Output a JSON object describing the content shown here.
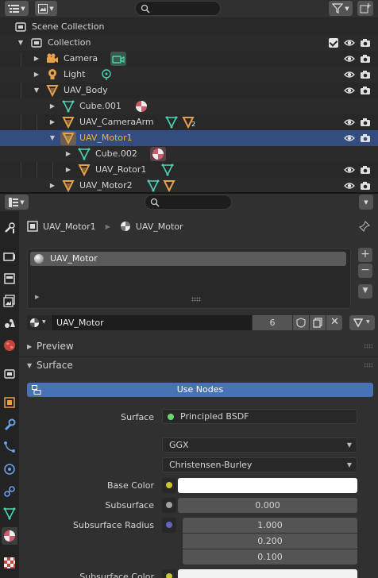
{
  "outliner": {
    "search_placeholder": "",
    "rows": [
      {
        "label": "Scene Collection"
      },
      {
        "label": "Collection"
      },
      {
        "label": "Camera"
      },
      {
        "label": "Light"
      },
      {
        "label": "UAV_Body"
      },
      {
        "label": "Cube.001"
      },
      {
        "label": "UAV_CameraArm",
        "badge": "2"
      },
      {
        "label": "UAV_Motor1"
      },
      {
        "label": "Cube.002"
      },
      {
        "label": "UAV_Rotor1"
      },
      {
        "label": "UAV_Motor2"
      }
    ]
  },
  "properties": {
    "search_placeholder": "",
    "breadcrumb": {
      "object": "UAV_Motor1",
      "material": "UAV_Motor"
    },
    "material_slot": "UAV_Motor",
    "material_name": "UAV_Motor",
    "user_count": "6",
    "panels": {
      "preview": "Preview",
      "surface": "Surface"
    },
    "use_nodes": "Use Nodes",
    "surface_label": "Surface",
    "surface_shader": "Principled BSDF",
    "distribution": "GGX",
    "subsurface_method": "Christensen-Burley",
    "base_color_label": "Base Color",
    "subsurface_label": "Subsurface",
    "subsurface_value": "0.000",
    "subsurface_radius_label": "Subsurface Radius",
    "subsurface_radius": [
      "1.000",
      "0.200",
      "0.100"
    ],
    "subsurface_color_label": "Subsurface Color"
  },
  "colors": {
    "selection": "#334d80",
    "active_text": "#ffaf29",
    "use_nodes": "#4772b3",
    "mesh_icon": "#4fd2b4",
    "object_icon": "#e8a04a"
  }
}
